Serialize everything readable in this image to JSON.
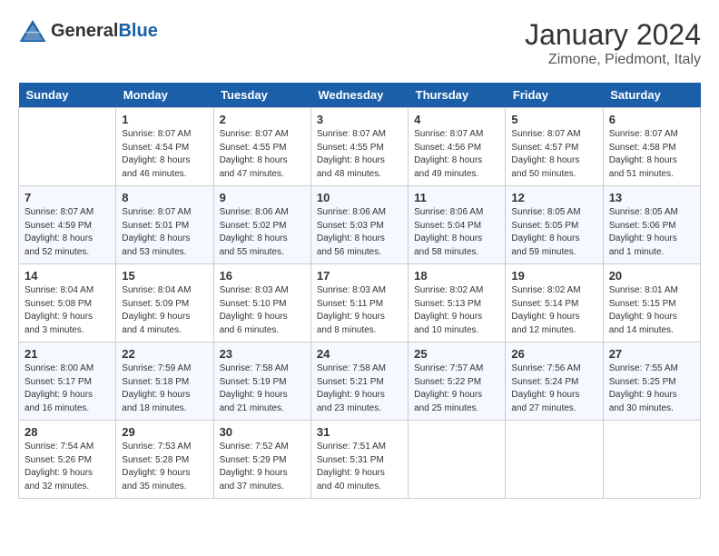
{
  "header": {
    "logo_general": "General",
    "logo_blue": "Blue",
    "month": "January 2024",
    "location": "Zimone, Piedmont, Italy"
  },
  "weekdays": [
    "Sunday",
    "Monday",
    "Tuesday",
    "Wednesday",
    "Thursday",
    "Friday",
    "Saturday"
  ],
  "weeks": [
    [
      {
        "day": "",
        "sunrise": "",
        "sunset": "",
        "daylight": ""
      },
      {
        "day": "1",
        "sunrise": "Sunrise: 8:07 AM",
        "sunset": "Sunset: 4:54 PM",
        "daylight": "Daylight: 8 hours and 46 minutes."
      },
      {
        "day": "2",
        "sunrise": "Sunrise: 8:07 AM",
        "sunset": "Sunset: 4:55 PM",
        "daylight": "Daylight: 8 hours and 47 minutes."
      },
      {
        "day": "3",
        "sunrise": "Sunrise: 8:07 AM",
        "sunset": "Sunset: 4:55 PM",
        "daylight": "Daylight: 8 hours and 48 minutes."
      },
      {
        "day": "4",
        "sunrise": "Sunrise: 8:07 AM",
        "sunset": "Sunset: 4:56 PM",
        "daylight": "Daylight: 8 hours and 49 minutes."
      },
      {
        "day": "5",
        "sunrise": "Sunrise: 8:07 AM",
        "sunset": "Sunset: 4:57 PM",
        "daylight": "Daylight: 8 hours and 50 minutes."
      },
      {
        "day": "6",
        "sunrise": "Sunrise: 8:07 AM",
        "sunset": "Sunset: 4:58 PM",
        "daylight": "Daylight: 8 hours and 51 minutes."
      }
    ],
    [
      {
        "day": "7",
        "sunrise": "Sunrise: 8:07 AM",
        "sunset": "Sunset: 4:59 PM",
        "daylight": "Daylight: 8 hours and 52 minutes."
      },
      {
        "day": "8",
        "sunrise": "Sunrise: 8:07 AM",
        "sunset": "Sunset: 5:01 PM",
        "daylight": "Daylight: 8 hours and 53 minutes."
      },
      {
        "day": "9",
        "sunrise": "Sunrise: 8:06 AM",
        "sunset": "Sunset: 5:02 PM",
        "daylight": "Daylight: 8 hours and 55 minutes."
      },
      {
        "day": "10",
        "sunrise": "Sunrise: 8:06 AM",
        "sunset": "Sunset: 5:03 PM",
        "daylight": "Daylight: 8 hours and 56 minutes."
      },
      {
        "day": "11",
        "sunrise": "Sunrise: 8:06 AM",
        "sunset": "Sunset: 5:04 PM",
        "daylight": "Daylight: 8 hours and 58 minutes."
      },
      {
        "day": "12",
        "sunrise": "Sunrise: 8:05 AM",
        "sunset": "Sunset: 5:05 PM",
        "daylight": "Daylight: 8 hours and 59 minutes."
      },
      {
        "day": "13",
        "sunrise": "Sunrise: 8:05 AM",
        "sunset": "Sunset: 5:06 PM",
        "daylight": "Daylight: 9 hours and 1 minute."
      }
    ],
    [
      {
        "day": "14",
        "sunrise": "Sunrise: 8:04 AM",
        "sunset": "Sunset: 5:08 PM",
        "daylight": "Daylight: 9 hours and 3 minutes."
      },
      {
        "day": "15",
        "sunrise": "Sunrise: 8:04 AM",
        "sunset": "Sunset: 5:09 PM",
        "daylight": "Daylight: 9 hours and 4 minutes."
      },
      {
        "day": "16",
        "sunrise": "Sunrise: 8:03 AM",
        "sunset": "Sunset: 5:10 PM",
        "daylight": "Daylight: 9 hours and 6 minutes."
      },
      {
        "day": "17",
        "sunrise": "Sunrise: 8:03 AM",
        "sunset": "Sunset: 5:11 PM",
        "daylight": "Daylight: 9 hours and 8 minutes."
      },
      {
        "day": "18",
        "sunrise": "Sunrise: 8:02 AM",
        "sunset": "Sunset: 5:13 PM",
        "daylight": "Daylight: 9 hours and 10 minutes."
      },
      {
        "day": "19",
        "sunrise": "Sunrise: 8:02 AM",
        "sunset": "Sunset: 5:14 PM",
        "daylight": "Daylight: 9 hours and 12 minutes."
      },
      {
        "day": "20",
        "sunrise": "Sunrise: 8:01 AM",
        "sunset": "Sunset: 5:15 PM",
        "daylight": "Daylight: 9 hours and 14 minutes."
      }
    ],
    [
      {
        "day": "21",
        "sunrise": "Sunrise: 8:00 AM",
        "sunset": "Sunset: 5:17 PM",
        "daylight": "Daylight: 9 hours and 16 minutes."
      },
      {
        "day": "22",
        "sunrise": "Sunrise: 7:59 AM",
        "sunset": "Sunset: 5:18 PM",
        "daylight": "Daylight: 9 hours and 18 minutes."
      },
      {
        "day": "23",
        "sunrise": "Sunrise: 7:58 AM",
        "sunset": "Sunset: 5:19 PM",
        "daylight": "Daylight: 9 hours and 21 minutes."
      },
      {
        "day": "24",
        "sunrise": "Sunrise: 7:58 AM",
        "sunset": "Sunset: 5:21 PM",
        "daylight": "Daylight: 9 hours and 23 minutes."
      },
      {
        "day": "25",
        "sunrise": "Sunrise: 7:57 AM",
        "sunset": "Sunset: 5:22 PM",
        "daylight": "Daylight: 9 hours and 25 minutes."
      },
      {
        "day": "26",
        "sunrise": "Sunrise: 7:56 AM",
        "sunset": "Sunset: 5:24 PM",
        "daylight": "Daylight: 9 hours and 27 minutes."
      },
      {
        "day": "27",
        "sunrise": "Sunrise: 7:55 AM",
        "sunset": "Sunset: 5:25 PM",
        "daylight": "Daylight: 9 hours and 30 minutes."
      }
    ],
    [
      {
        "day": "28",
        "sunrise": "Sunrise: 7:54 AM",
        "sunset": "Sunset: 5:26 PM",
        "daylight": "Daylight: 9 hours and 32 minutes."
      },
      {
        "day": "29",
        "sunrise": "Sunrise: 7:53 AM",
        "sunset": "Sunset: 5:28 PM",
        "daylight": "Daylight: 9 hours and 35 minutes."
      },
      {
        "day": "30",
        "sunrise": "Sunrise: 7:52 AM",
        "sunset": "Sunset: 5:29 PM",
        "daylight": "Daylight: 9 hours and 37 minutes."
      },
      {
        "day": "31",
        "sunrise": "Sunrise: 7:51 AM",
        "sunset": "Sunset: 5:31 PM",
        "daylight": "Daylight: 9 hours and 40 minutes."
      },
      {
        "day": "",
        "sunrise": "",
        "sunset": "",
        "daylight": ""
      },
      {
        "day": "",
        "sunrise": "",
        "sunset": "",
        "daylight": ""
      },
      {
        "day": "",
        "sunrise": "",
        "sunset": "",
        "daylight": ""
      }
    ]
  ]
}
